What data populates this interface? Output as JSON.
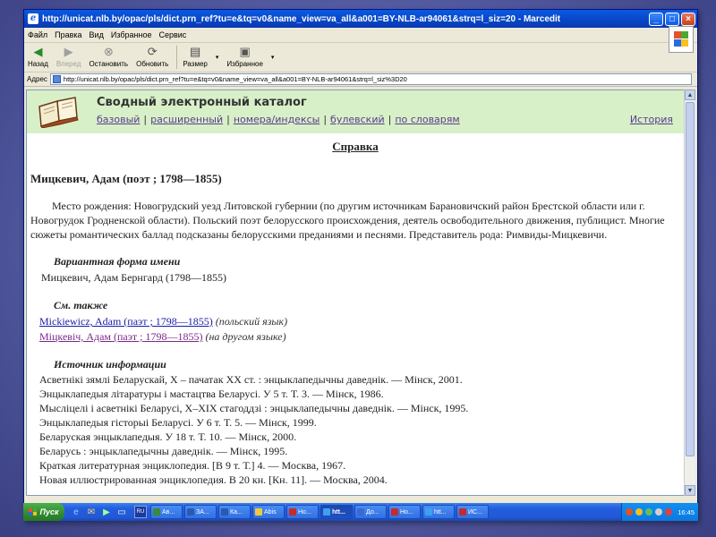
{
  "window": {
    "title": "http://unicat.nlb.by/opac/pls/dict.prn_ref?tu=e&tq=v0&name_view=va_all&a001=BY-NLB-ar94061&strq=l_siz=20 - Marcedit"
  },
  "menu": [
    "Файл",
    "Правка",
    "Вид",
    "Избранное",
    "Сервис"
  ],
  "toolbar": {
    "back": "Назад",
    "forward": "Вперед",
    "stop": "Остановить",
    "refresh": "Обновить",
    "size": "Размер",
    "favorites": "Избранное"
  },
  "address": {
    "label": "Адрес",
    "url": "http://unicat.nlb.by/opac/pls/dict.prn_ref?tu=e&tq=v0&name_view=va_all&a001=BY-NLB-ar94061&strq=l_siz%3D20"
  },
  "catalog": {
    "title": "Сводный электронный каталог",
    "nav": [
      "базовый",
      "расширенный",
      "номера/индексы",
      "булевский",
      "по словарям"
    ],
    "history": "История"
  },
  "ref": {
    "heading": "Справка",
    "person": "Мицкевич, Адам (поэт ; 1798—1855)",
    "description": "Место рождения: Новогрудский уезд Литовской губернии (по другим источникам Барановичский район Брестской области или г. Новогрудок Гродненской области). Польский поэт белорусского происхождения, деятель освободительного движения, публицист. Многие сюжеты романтических баллад подсказаны белорусскими преданиями и песнями. Представитель рода: Римвиды-Мицкевичи.",
    "variant_heading": "Вариантная форма имени",
    "variant": "Мицкевич, Адам Бернгард (1798—1855)",
    "see_also_heading": "См. также",
    "see_also": [
      {
        "link": "Mickiewicz, Adam (паэт ; 1798—1855)",
        "note": "(польский язык)"
      },
      {
        "link": "Міцкевіч, Адам (паэт ; 1798—1855)",
        "note": "(на другом языке)"
      }
    ],
    "sources_heading": "Источник информации",
    "sources": [
      "Асветнікі зямлі Беларускай, X – пачатак XX ст. : энцыклапедычны даведнік. — Мінск, 2001.",
      "Энцыклапедыя літаратуры і мастацтва Беларусі. У 5 т. Т. 3. — Мінск, 1986.",
      "Мысліцелі і асветнікі Беларусі, X–XIX стагоддзі : энцыклапедычны даведнік. — Мінск, 1995.",
      "Энцыклапедыя гісторыі Беларусі. У 6 т. Т. 5. — Мінск, 1999.",
      "Беларуская энцыклапедыя. У 18 т. Т. 10. — Мінск, 2000.",
      "Беларусь : энцыклапедычны даведнік. — Мінск, 1995.",
      "Краткая литературная энциклопедия. [В 9 т. Т.] 4. — Москва, 1967.",
      "Новая иллюстрированная энциклопедия. В 20 кн. [Кн. 11]. — Москва, 2004."
    ]
  },
  "taskbar": {
    "start": "Пуск",
    "lang": "RU",
    "tasks": [
      "Ав...",
      "ЗА...",
      "Ка...",
      "Abis",
      "Но...",
      "htt...",
      "До...",
      "Но...",
      "htt...",
      "ИС..."
    ],
    "clock": "16:45"
  },
  "colors": {
    "banner_bg": "#d8f0c8",
    "link": "#1a1aa8",
    "visited_link": "#7a2a8a",
    "nav_link": "#5a3c8c"
  }
}
